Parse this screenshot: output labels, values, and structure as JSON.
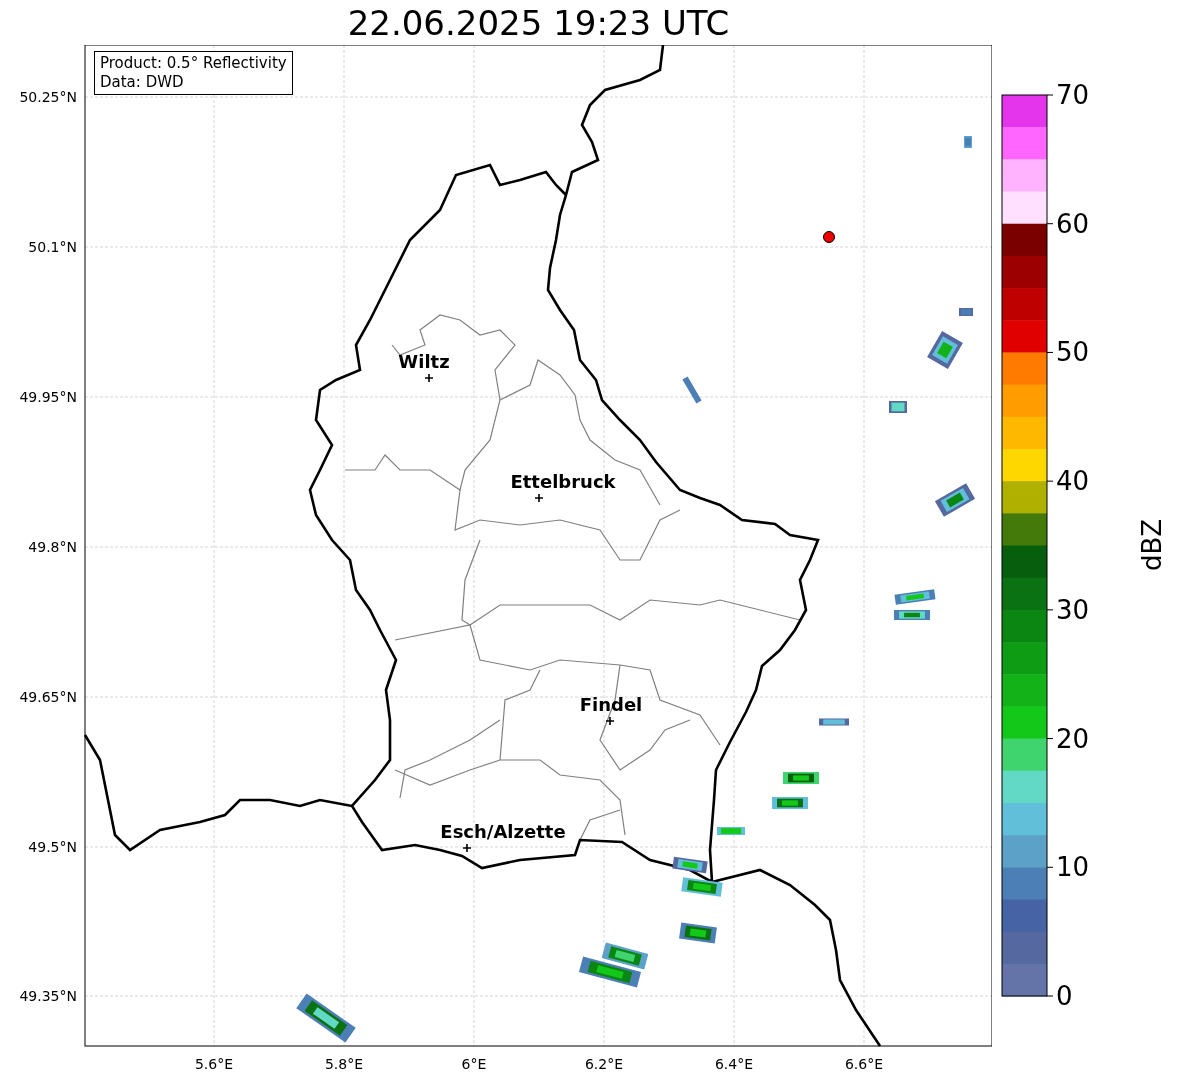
{
  "title": "22.06.2025 19:23 UTC",
  "info_box": [
    "Product: 0.5° Reflectivity",
    "Data: DWD"
  ],
  "y_ticks": [
    "50.25°N",
    "50.1°N",
    "49.95°N",
    "49.8°N",
    "49.65°N",
    "49.5°N",
    "49.35°N"
  ],
  "x_ticks": [
    "5.6°E",
    "5.8°E",
    "6°E",
    "6.2°E",
    "6.4°E",
    "6.6°E"
  ],
  "cities": [
    {
      "name": "Wiltz"
    },
    {
      "name": "Ettelbruck"
    },
    {
      "name": "Findel"
    },
    {
      "name": "Esch/Alzette"
    }
  ],
  "colorbar": {
    "label": "dBZ",
    "ticks": [
      "70",
      "60",
      "50",
      "40",
      "30",
      "20",
      "10",
      "0"
    ],
    "segments": [
      {
        "color": "#e535ec"
      },
      {
        "color": "#ff66ff"
      },
      {
        "color": "#ffb3ff"
      },
      {
        "color": "#ffe0ff"
      },
      {
        "color": "#7a0000"
      },
      {
        "color": "#9c0000"
      },
      {
        "color": "#be0000"
      },
      {
        "color": "#e00000"
      },
      {
        "color": "#ff7b00"
      },
      {
        "color": "#ff9d00"
      },
      {
        "color": "#ffb800"
      },
      {
        "color": "#ffd700"
      },
      {
        "color": "#b0b000"
      },
      {
        "color": "#437a0a"
      },
      {
        "color": "#075e0d"
      },
      {
        "color": "#0a7212"
      },
      {
        "color": "#0c8613"
      },
      {
        "color": "#0f9c15"
      },
      {
        "color": "#12b218"
      },
      {
        "color": "#14c81a"
      },
      {
        "color": "#40d46e"
      },
      {
        "color": "#62d9c5"
      },
      {
        "color": "#62bfda"
      },
      {
        "color": "#5ba1c8"
      },
      {
        "color": "#4c7fb6"
      },
      {
        "color": "#4663a5"
      },
      {
        "color": "#5568a0"
      },
      {
        "color": "#6473a8"
      }
    ]
  }
}
